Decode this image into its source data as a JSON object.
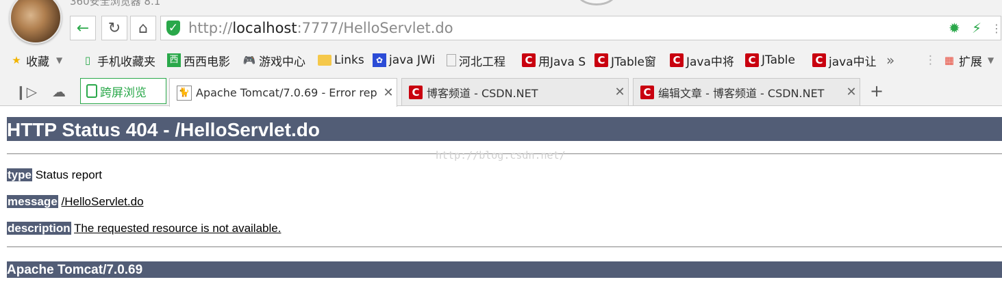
{
  "browser": {
    "window_title": "360安全浏览器 8.1",
    "address_bar": {
      "scheme": "http://",
      "host": "localhost",
      "rest": ":7777/HelloServlet.do",
      "secure_icon": "shield-check-icon"
    },
    "bookmarks": [
      {
        "label": "收藏",
        "icon": "star-icon",
        "has_dropdown": true
      },
      {
        "label": "手机收藏夹",
        "icon": "phone-icon"
      },
      {
        "label": "西西电影",
        "icon": "xixi-icon"
      },
      {
        "label": "游戏中心",
        "icon": "gamepad-icon"
      },
      {
        "label": "Links",
        "icon": "folder-icon"
      },
      {
        "label": "java JWi",
        "icon": "paw-icon"
      },
      {
        "label": "河北工程",
        "icon": "page-icon"
      },
      {
        "label": "用Java S",
        "icon": "csdn-icon"
      },
      {
        "label": "JTable窗",
        "icon": "csdn-icon"
      },
      {
        "label": "Java中将",
        "icon": "csdn-icon"
      },
      {
        "label": "JTable",
        "icon": "csdn-icon"
      },
      {
        "label": "java中让",
        "icon": "csdn-icon"
      }
    ],
    "bookmarks_more": "»",
    "extensions_label": "扩展",
    "split_view_label": "跨屏浏览",
    "tabs": [
      {
        "title": "Apache Tomcat/7.0.69 - Error rep",
        "icon": "tomcat-icon",
        "active": true
      },
      {
        "title": "博客频道 - CSDN.NET",
        "icon": "csdn-icon",
        "active": false
      },
      {
        "title": "编辑文章 - 博客频道 - CSDN.NET",
        "icon": "csdn-icon",
        "active": false
      }
    ],
    "csdn_letter": "C"
  },
  "page": {
    "heading": "HTTP Status 404 - /HelloServlet.do",
    "fields": [
      {
        "key": "type",
        "value": "Status report",
        "underline": false
      },
      {
        "key": "message",
        "value": "/HelloServlet.do",
        "underline": true
      },
      {
        "key": "description",
        "value": "The requested resource is not available.",
        "underline": true
      }
    ],
    "footer": "Apache Tomcat/7.0.69",
    "watermark": "http://blog.csdn.net/"
  },
  "colors": {
    "tomcat_header": "#525d76",
    "csdn_red": "#c9000f",
    "accent_green": "#2aa84a"
  }
}
